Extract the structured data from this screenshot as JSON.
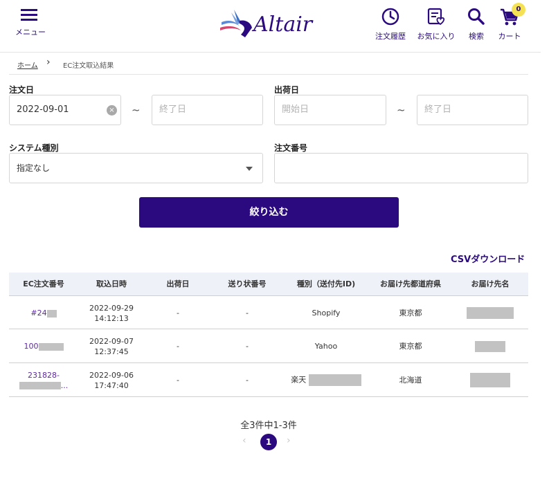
{
  "header": {
    "menu_label": "メニュー",
    "logo_text": "Altair",
    "nav": {
      "history_label": "注文履歴",
      "favorites_label": "お気に入り",
      "search_label": "検索",
      "cart_label": "カート",
      "cart_count": "0"
    },
    "icons": [
      "menu-icon",
      "clock-icon",
      "favorites-list-icon",
      "search-icon",
      "cart-icon"
    ]
  },
  "breadcrumb": {
    "home": "ホーム",
    "separator": "›",
    "current": "EC注文取込結果"
  },
  "form": {
    "order_date_label": "注文日",
    "order_date_start_value": "2022-09-01",
    "order_date_end_placeholder": "終了日",
    "ship_date_label": "出荷日",
    "ship_date_start_placeholder": "開始日",
    "ship_date_end_placeholder": "終了日",
    "range_sep": "~",
    "system_type_label": "システム種別",
    "system_type_value": "指定なし",
    "order_number_label": "注文番号",
    "order_number_value": "",
    "filter_button": "絞り込む"
  },
  "csv_download": "CSVダウンロード",
  "table": {
    "headers": [
      "EC注文番号",
      "取込日時",
      "出荷日",
      "送り状番号",
      "種別（送付先ID)",
      "お届け先都道府県",
      "お届け先名"
    ],
    "rows": [
      {
        "order_no": "#24",
        "imported_date": "2022-09-29",
        "imported_time": "14:12:13",
        "ship_date": "-",
        "tracking_no": "-",
        "type": "Shopify",
        "prefecture": "東京都"
      },
      {
        "order_no": "100",
        "imported_date": "2022-09-07",
        "imported_time": "12:37:45",
        "ship_date": "-",
        "tracking_no": "-",
        "type": "Yahoo",
        "prefecture": "東京都"
      },
      {
        "order_no": "231828-",
        "order_no_suffix": "...",
        "imported_date": "2022-09-06",
        "imported_time": "17:47:40",
        "ship_date": "-",
        "tracking_no": "-",
        "type": "楽天",
        "prefecture": "北海道"
      }
    ]
  },
  "pagination": {
    "summary": "全3件中1-3件",
    "prev": "‹",
    "current_page": "1",
    "next": "›"
  },
  "colors": {
    "brand": "#2a0a7e",
    "badge": "#f4e254",
    "table_header_bg": "#eef1f7"
  }
}
